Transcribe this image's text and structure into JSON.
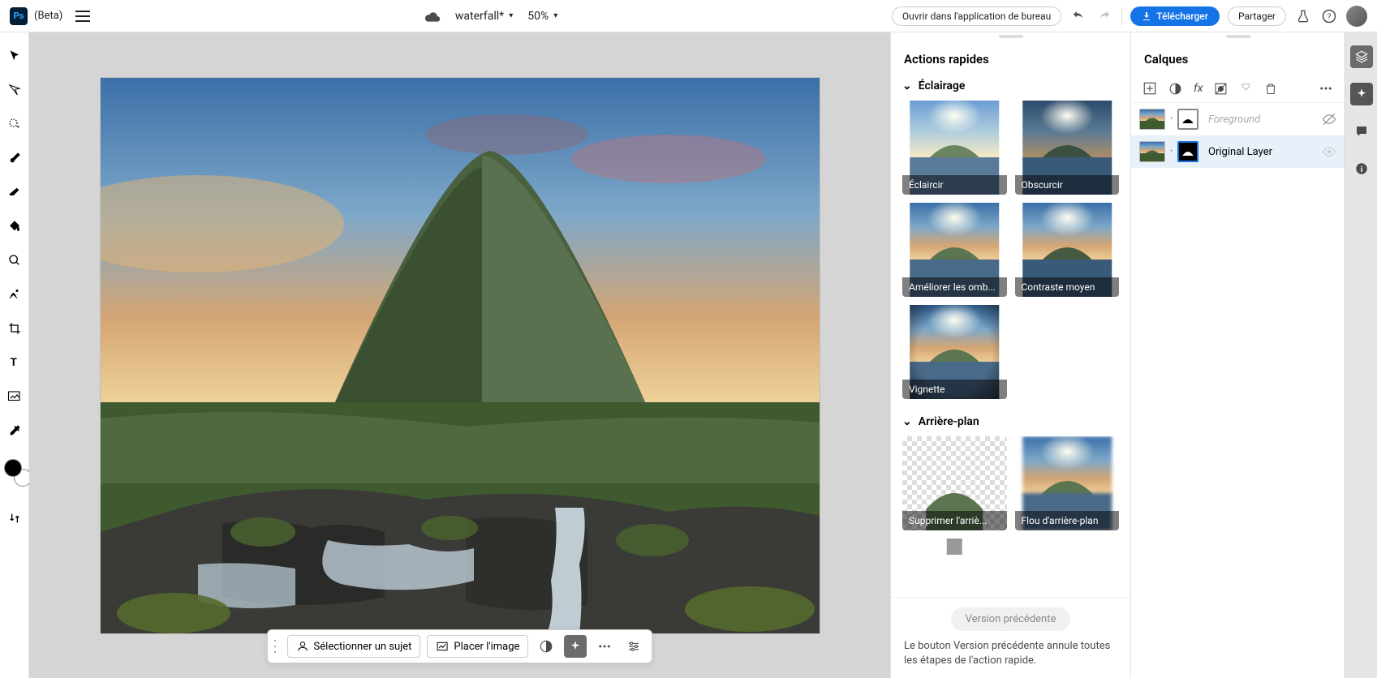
{
  "header": {
    "beta_label": "(Beta)",
    "document_name": "waterfall*",
    "zoom": "50%",
    "open_desktop": "Ouvrir dans l'application de bureau",
    "download": "Télécharger",
    "share": "Partager"
  },
  "tools": [
    "move",
    "path",
    "magic-wand",
    "brush",
    "eraser",
    "clone-stamp",
    "blur",
    "color-picker",
    "crop",
    "text",
    "shape",
    "eyedropper"
  ],
  "canvas": {
    "subject": "Mountain waterfall landscape at sunset"
  },
  "floatbar": {
    "select_subject": "Sélectionner un sujet",
    "place_image": "Placer l'image"
  },
  "quick_actions": {
    "title": "Actions rapides",
    "sections": {
      "lighting": {
        "label": "Éclairage",
        "items": [
          "Éclaircir",
          "Obscurcir",
          "Améliorer les omb...",
          "Contraste moyen",
          "Vignette"
        ]
      },
      "background": {
        "label": "Arrière-plan",
        "items": [
          "Supprimer l'arriè...",
          "Flou d'arrière-plan"
        ]
      }
    },
    "previous_version": "Version précédente",
    "help_text": "Le bouton Version précédente annule toutes les étapes de l'action rapide."
  },
  "layers": {
    "title": "Calques",
    "items": [
      {
        "name": "Foreground",
        "visible": false,
        "selected": false
      },
      {
        "name": "Original Layer",
        "visible": true,
        "selected": true
      }
    ]
  }
}
